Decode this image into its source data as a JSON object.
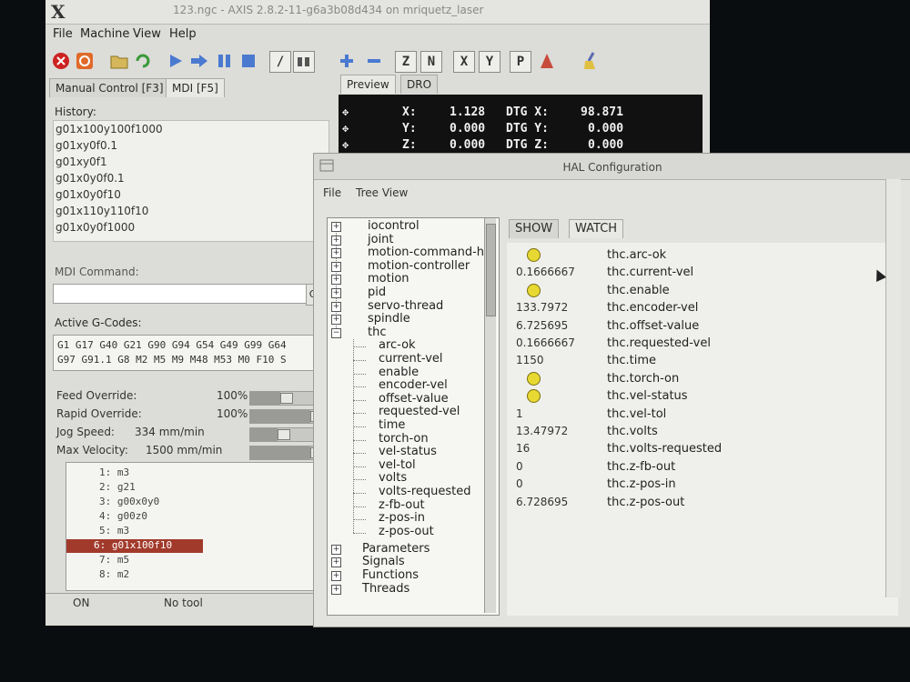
{
  "axis": {
    "logo": "X",
    "title": "123.ngc - AXIS 2.8.2-11-g6a3b08d434 on mriquetz_laser",
    "menu": [
      "File",
      "Machine",
      "View",
      "Help"
    ],
    "toolbar_buttons": [
      "Z",
      "N",
      "X",
      "Y",
      "P"
    ],
    "tabs": [
      "Manual Control [F3]",
      "MDI [F5]"
    ],
    "history_label": "History:",
    "history": [
      "g01x100y100f1000",
      "g01xy0f0.1",
      "g01xy0f1",
      "g01x0y0f0.1",
      "g01x0y0f10",
      "g01x110y110f10",
      "g01x0y0f1000"
    ],
    "mdi_label": "MDI Command:",
    "mdi_go": "G",
    "gcodes_label": "Active G-Codes:",
    "gcodes": [
      "G1 G17 G40 G21 G90 G94 G54 G49 G99 G64",
      "G97 G91.1 G8 M2 M5 M9 M48 M53 M0 F10 S"
    ],
    "overrides": [
      {
        "label": "Feed Override:",
        "value": "100%",
        "level": 0.5
      },
      {
        "label": "Rapid Override:",
        "value": "100%",
        "level": 1.0
      },
      {
        "label": "Jog Speed:",
        "value": "334 mm/min",
        "level": 0.45
      },
      {
        "label": "Max Velocity:",
        "value": "1500 mm/min",
        "level": 1.0
      }
    ],
    "program_lines": [
      "1: m3",
      "2: g21",
      "3: g00x0y0",
      "4: g00z0",
      "5: m3",
      "6: g01x100f10",
      "7: m5",
      "8: m2"
    ],
    "current_line": 5,
    "status_state": "ON",
    "status_tool": "No tool",
    "right_tabs": [
      "Preview",
      "DRO"
    ],
    "dro": [
      {
        "axis": "X:",
        "pos": "1.128",
        "dtg_label": "DTG X:",
        "dtg": "98.871"
      },
      {
        "axis": "Y:",
        "pos": "0.000",
        "dtg_label": "DTG Y:",
        "dtg": "0.000"
      },
      {
        "axis": "Z:",
        "pos": "0.000",
        "dtg_label": "DTG Z:",
        "dtg": "0.000"
      }
    ]
  },
  "hal": {
    "title": "HAL Configuration",
    "menu": [
      "File",
      "Tree View"
    ],
    "tree_top": [
      "iocontrol",
      "joint",
      "motion-command-h",
      "motion-controller",
      "motion",
      "pid",
      "servo-thread",
      "spindle",
      "thc"
    ],
    "tree_thc": [
      "arc-ok",
      "current-vel",
      "enable",
      "encoder-vel",
      "offset-value",
      "requested-vel",
      "time",
      "torch-on",
      "vel-status",
      "vel-tol",
      "volts",
      "volts-requested",
      "z-fb-out",
      "z-pos-in",
      "z-pos-out"
    ],
    "tree_bottom": [
      "Parameters",
      "Signals",
      "Functions",
      "Threads"
    ],
    "tabs": [
      "SHOW",
      "WATCH"
    ],
    "watch": [
      {
        "value": "",
        "led": true,
        "pin": "thc.arc-ok"
      },
      {
        "value": "0.1666667",
        "led": false,
        "pin": "thc.current-vel"
      },
      {
        "value": "",
        "led": true,
        "pin": "thc.enable"
      },
      {
        "value": "133.7972",
        "led": false,
        "pin": "thc.encoder-vel"
      },
      {
        "value": "6.725695",
        "led": false,
        "pin": "thc.offset-value"
      },
      {
        "value": "0.1666667",
        "led": false,
        "pin": "thc.requested-vel"
      },
      {
        "value": "1150",
        "led": false,
        "pin": "thc.time"
      },
      {
        "value": "",
        "led": true,
        "pin": "thc.torch-on"
      },
      {
        "value": "",
        "led": true,
        "pin": "thc.vel-status"
      },
      {
        "value": "1",
        "led": false,
        "pin": "thc.vel-tol"
      },
      {
        "value": "13.47972",
        "led": false,
        "pin": "thc.volts"
      },
      {
        "value": "16",
        "led": false,
        "pin": "thc.volts-requested"
      },
      {
        "value": "0",
        "led": false,
        "pin": "thc.z-fb-out"
      },
      {
        "value": "0",
        "led": false,
        "pin": "thc.z-pos-in"
      },
      {
        "value": "6.728695",
        "led": false,
        "pin": "thc.z-pos-out"
      }
    ]
  }
}
